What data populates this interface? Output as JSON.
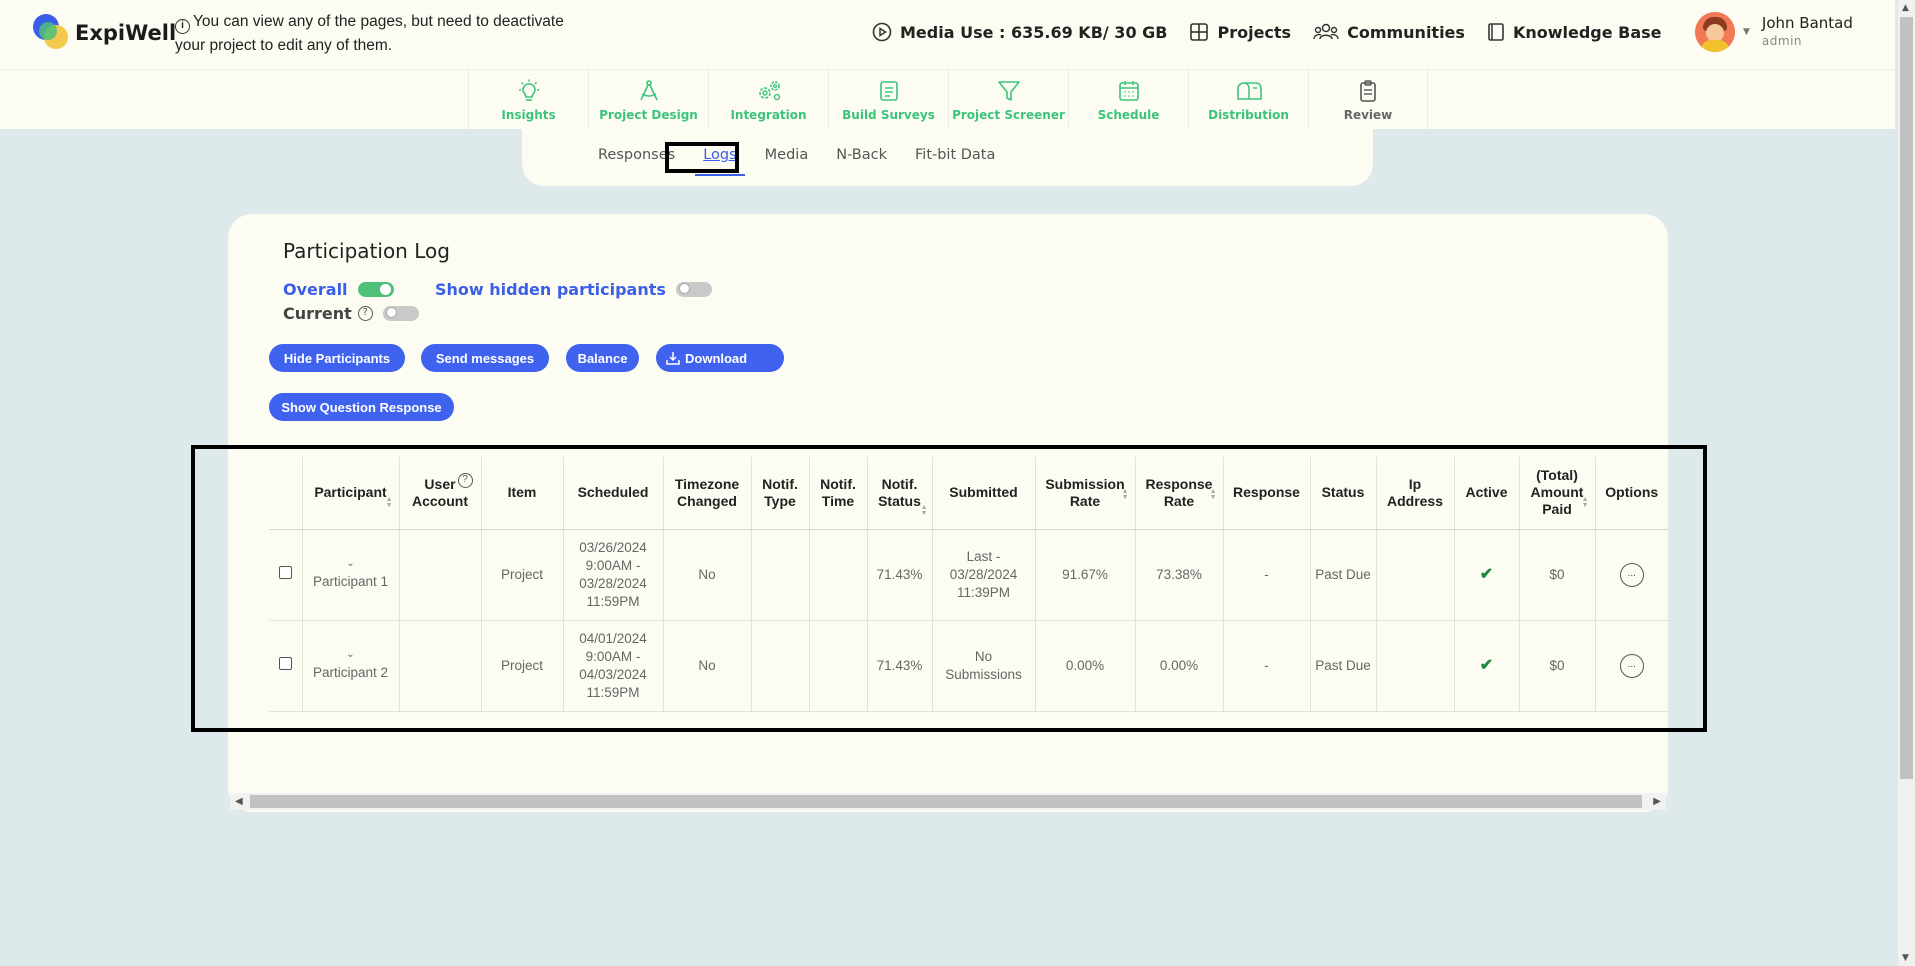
{
  "brand": {
    "name": "ExpiWell"
  },
  "notice": {
    "text": "You can view any of the pages, but need to deactivate your project to edit any of them."
  },
  "topnav": {
    "media_use": "Media Use : 635.69 KB/ 30 GB",
    "projects": "Projects",
    "communities": "Communities",
    "knowledge_base": "Knowledge Base"
  },
  "user": {
    "name": "John Bantad",
    "role": "admin"
  },
  "modules": [
    {
      "label": "Insights",
      "icon": "lightbulb-icon"
    },
    {
      "label": "Project Design",
      "icon": "compass-icon"
    },
    {
      "label": "Integration",
      "icon": "gears-icon"
    },
    {
      "label": "Build Surveys",
      "icon": "form-icon"
    },
    {
      "label": "Project Screener",
      "icon": "filter-icon"
    },
    {
      "label": "Schedule",
      "icon": "calendar-icon"
    },
    {
      "label": "Distribution",
      "icon": "mailbox-icon"
    },
    {
      "label": "Review",
      "icon": "clipboard-icon"
    }
  ],
  "subtabs": [
    "Responses",
    "Logs",
    "Media",
    "N-Back",
    "Fit-bit Data"
  ],
  "active_subtab": "Logs",
  "card": {
    "title": "Participation Log",
    "overall_label": "Overall",
    "current_label": "Current",
    "hidden_label": "Show hidden participants",
    "overall_on": true,
    "current_on": false,
    "hidden_on": false
  },
  "buttons": {
    "hide": "Hide Participants",
    "send": "Send messages",
    "balance": "Balance",
    "download": "Download",
    "show_q": "Show Question Response"
  },
  "table": {
    "headers": [
      "Participant",
      "User Account",
      "Item",
      "Scheduled",
      "Timezone Changed",
      "Notif. Type",
      "Notif. Time",
      "Notif. Status",
      "Submitted",
      "Submission Rate",
      "Response Rate",
      "Response",
      "Status",
      "Ip Address",
      "Active",
      "(Total) Amount Paid",
      "Options"
    ],
    "rows": [
      {
        "participant": "Participant 1",
        "user_account": "",
        "item": "Project",
        "scheduled": "03/26/2024 9:00AM - 03/28/2024 11:59PM",
        "timezone_changed": "No",
        "notif_type": "",
        "notif_time": "",
        "notif_status": "71.43%",
        "submitted": "Last - 03/28/2024 11:39PM",
        "submission_rate": "91.67%",
        "response_rate": "73.38%",
        "response": "-",
        "status": "Past Due",
        "ip_address": "",
        "active": "✔",
        "amount_paid": "$0",
        "options": "..."
      },
      {
        "participant": "Participant 2",
        "user_account": "",
        "item": "Project",
        "scheduled": "04/01/2024 9:00AM - 04/03/2024 11:59PM",
        "timezone_changed": "No",
        "notif_type": "",
        "notif_time": "",
        "notif_status": "71.43%",
        "submitted": "No Submissions",
        "submission_rate": "0.00%",
        "response_rate": "0.00%",
        "response": "-",
        "status": "Past Due",
        "ip_address": "",
        "active": "✔",
        "amount_paid": "$0",
        "options": "..."
      }
    ]
  },
  "colors": {
    "accent": "#3f63ef",
    "green": "#3cc47a",
    "bg": "#dde9eb",
    "panel": "#fdfcf3"
  }
}
